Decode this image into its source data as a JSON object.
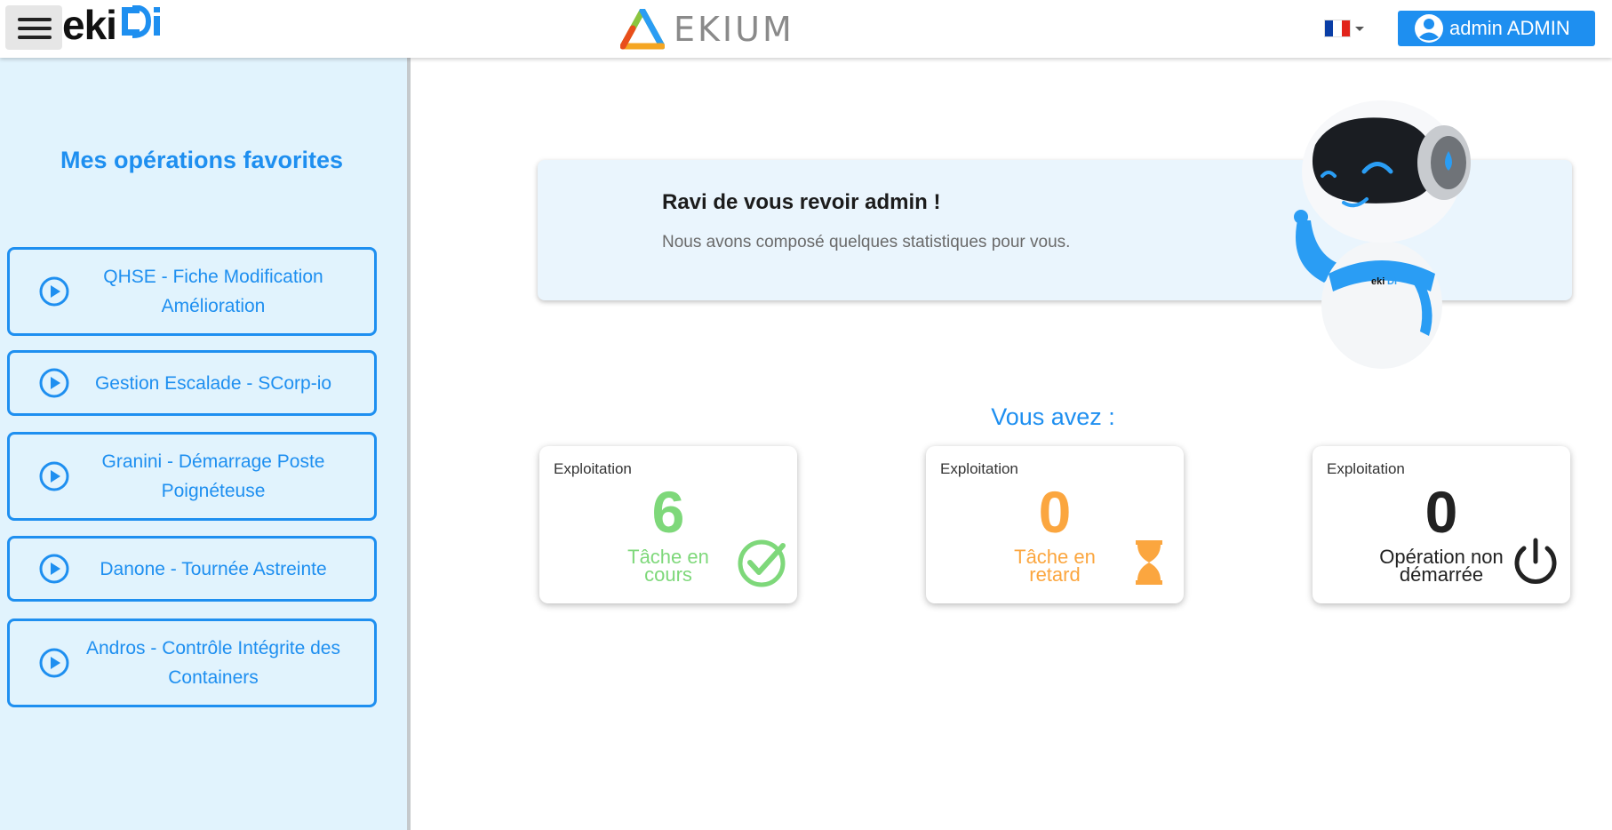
{
  "header": {
    "menu_icon": "hamburger-menu-icon",
    "logo_left_text": "eki",
    "logo_left_accent": "Di",
    "center_logo_text": "EKIUM",
    "language": "fr",
    "user_label": "admin ADMIN",
    "user_icon": "account-circle-icon"
  },
  "sidebar": {
    "title": "Mes opérations favorites",
    "items": [
      {
        "label": "QHSE - Fiche Modification Amélioration"
      },
      {
        "label": "Gestion Escalade - SCorp-io"
      },
      {
        "label": "Granini - Démarrage Poste Poignéteuse"
      },
      {
        "label": "Danone - Tournée Astreinte"
      },
      {
        "label": "Andros - Contrôle Intégrite des Containers"
      }
    ]
  },
  "welcome": {
    "title": "Ravi de vous revoir admin !",
    "subtitle": "Nous avons composé quelques statistiques pour vous."
  },
  "stats": {
    "heading": "Vous avez :",
    "cards": [
      {
        "category": "Exploitation",
        "value": "6",
        "label": "Tâche en cours",
        "color": "#7ed87a",
        "icon": "check-circle-icon"
      },
      {
        "category": "Exploitation",
        "value": "0",
        "label": "Tâche en retard",
        "color": "#fba63f",
        "icon": "hourglass-icon"
      },
      {
        "category": "Exploitation",
        "value": "0",
        "label": "Opération non démarrée",
        "color": "#222222",
        "icon": "power-icon"
      }
    ]
  },
  "colors": {
    "accent": "#1e8ff0",
    "sidebar_bg": "#e1f3fd",
    "welcome_bg": "#eaf5fd"
  }
}
